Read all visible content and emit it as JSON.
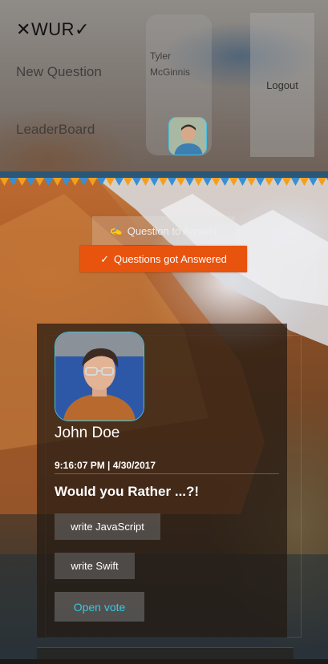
{
  "header": {
    "brand": {
      "prefix": "✕",
      "text": "WUR",
      "suffix": "✓"
    },
    "nav": {
      "new_question": "New Question",
      "leaderboard": "LeaderBoard"
    },
    "user": {
      "name": "Tyler McGinnis"
    },
    "logout_label": "Logout"
  },
  "tabs": {
    "to_answer": {
      "icon": "edit-icon",
      "label": "Question to Answer",
      "glyph": "✍"
    },
    "answered": {
      "icon": "check-icon",
      "label": "Questions got Answered",
      "glyph": "✓",
      "active": true
    }
  },
  "question_card": {
    "author": "John Doe",
    "timestamp": "9:16:07 PM | 4/30/2017",
    "title": "Would you Rather ...?!",
    "options": [
      "write JavaScript",
      "write Swift"
    ],
    "open_vote_label": "Open vote"
  },
  "colors": {
    "accent_orange": "#e8530e",
    "accent_cyan": "#36c9e6",
    "divider_blue": "#2b5675",
    "bunting_orange": "#f0a020",
    "bunting_blue": "#3a8fd0"
  }
}
